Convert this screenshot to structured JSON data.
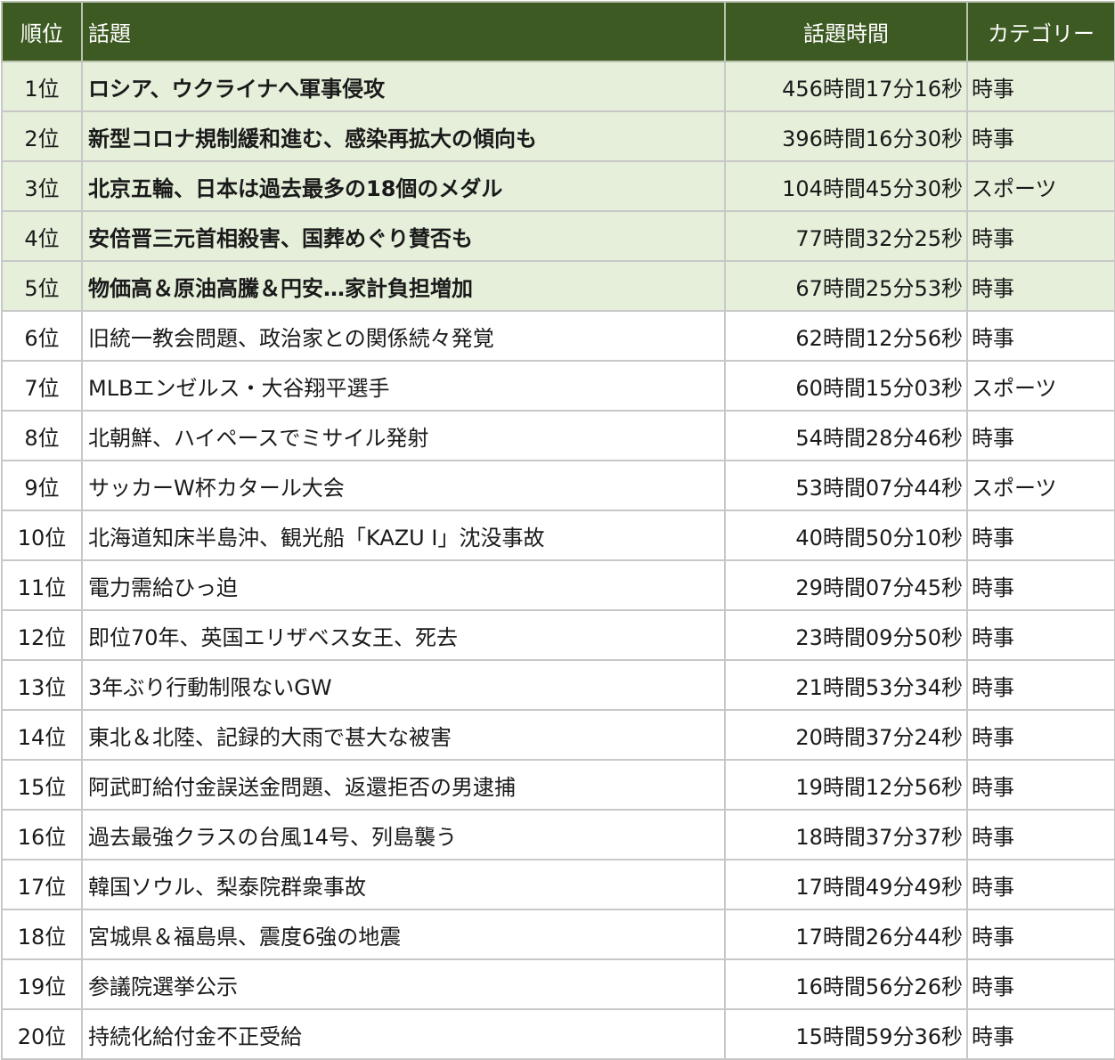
{
  "header": {
    "rank": "順位",
    "topic": "話題",
    "time": "話題時間",
    "category": "カテゴリー"
  },
  "rows": [
    {
      "rank": "1位",
      "topic": "ロシア、ウクライナへ軍事侵攻",
      "time": "456時間17分16秒",
      "category": "時事"
    },
    {
      "rank": "2位",
      "topic": "新型コロナ規制緩和進む、感染再拡大の傾向も",
      "time": "396時間16分30秒",
      "category": "時事"
    },
    {
      "rank": "3位",
      "topic": "北京五輪、日本は過去最多の18個のメダル",
      "time": "104時間45分30秒",
      "category": "スポーツ"
    },
    {
      "rank": "4位",
      "topic": "安倍晋三元首相殺害、国葬めぐり賛否も",
      "time": "77時間32分25秒",
      "category": "時事"
    },
    {
      "rank": "5位",
      "topic": "物価高＆原油高騰＆円安…家計負担増加",
      "time": "67時間25分53秒",
      "category": "時事"
    },
    {
      "rank": "6位",
      "topic": "旧統一教会問題、政治家との関係続々発覚",
      "time": "62時間12分56秒",
      "category": "時事"
    },
    {
      "rank": "7位",
      "topic": "MLBエンゼルス・大谷翔平選手",
      "time": "60時間15分03秒",
      "category": "スポーツ"
    },
    {
      "rank": "8位",
      "topic": "北朝鮮、ハイペースでミサイル発射",
      "time": "54時間28分46秒",
      "category": "時事"
    },
    {
      "rank": "9位",
      "topic": "サッカーW杯カタール大会",
      "time": "53時間07分44秒",
      "category": "スポーツ"
    },
    {
      "rank": "10位",
      "topic": "北海道知床半島沖、観光船「KAZU Ⅰ」沈没事故",
      "time": "40時間50分10秒",
      "category": "時事"
    },
    {
      "rank": "11位",
      "topic": "電力需給ひっ迫",
      "time": "29時間07分45秒",
      "category": "時事"
    },
    {
      "rank": "12位",
      "topic": "即位70年、英国エリザベス女王、死去",
      "time": "23時間09分50秒",
      "category": "時事"
    },
    {
      "rank": "13位",
      "topic": "3年ぶり行動制限ないGW",
      "time": "21時間53分34秒",
      "category": "時事"
    },
    {
      "rank": "14位",
      "topic": "東北＆北陸、記録的大雨で甚大な被害",
      "time": "20時間37分24秒",
      "category": "時事"
    },
    {
      "rank": "15位",
      "topic": "阿武町給付金誤送金問題、返還拒否の男逮捕",
      "time": "19時間12分56秒",
      "category": "時事"
    },
    {
      "rank": "16位",
      "topic": "過去最強クラスの台風14号、列島襲う",
      "time": "18時間37分37秒",
      "category": "時事"
    },
    {
      "rank": "17位",
      "topic": "韓国ソウル、梨泰院群衆事故",
      "time": "17時間49分49秒",
      "category": "時事"
    },
    {
      "rank": "18位",
      "topic": "宮城県＆福島県、震度6強の地震",
      "time": "17時間26分44秒",
      "category": "時事"
    },
    {
      "rank": "19位",
      "topic": "参議院選挙公示",
      "time": "16時間56分26秒",
      "category": "時事"
    },
    {
      "rank": "20位",
      "topic": "持続化給付金不正受給",
      "time": "15時間59分36秒",
      "category": "時事"
    }
  ]
}
